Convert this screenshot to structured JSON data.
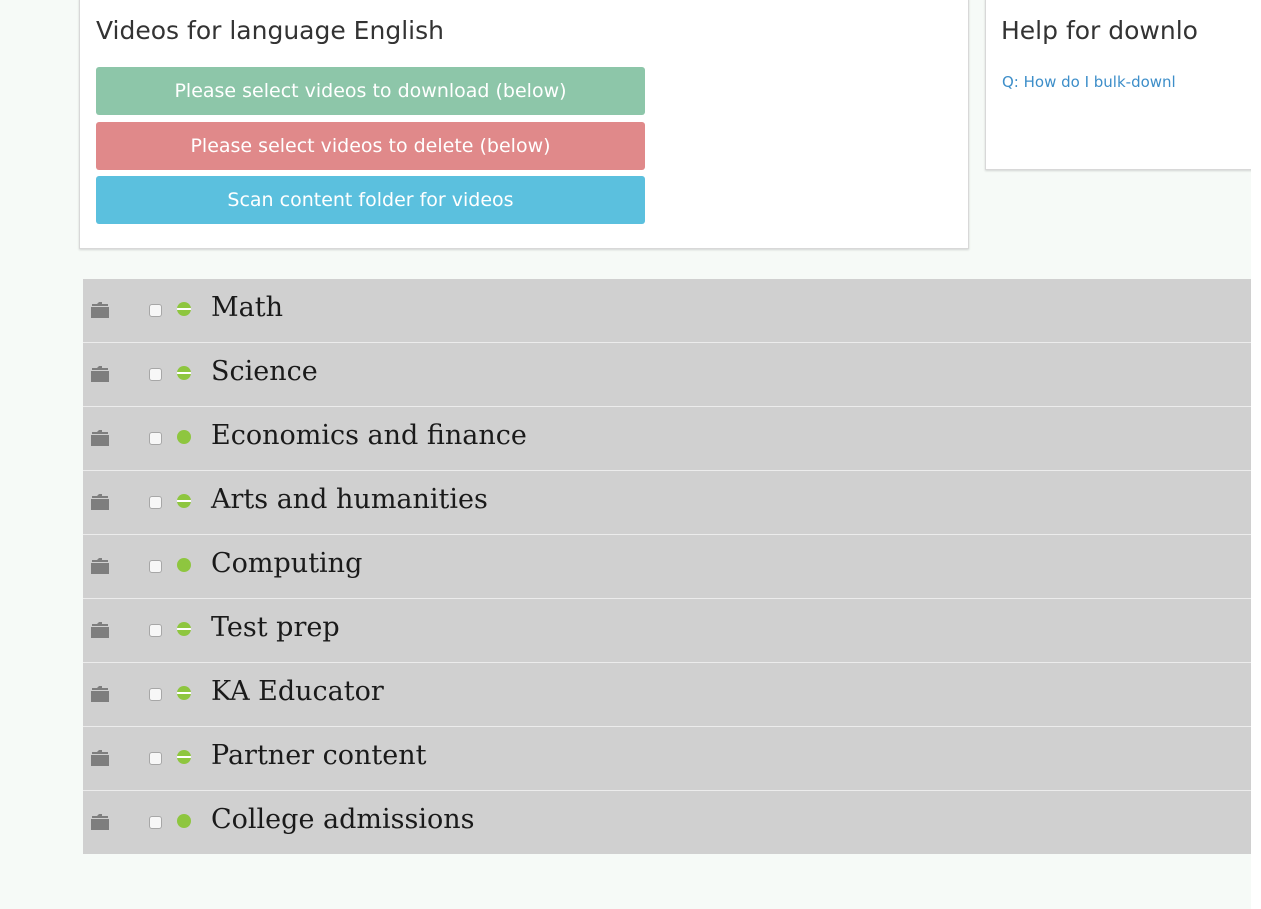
{
  "videos_panel": {
    "title": "Videos for language English",
    "download_button": "Please select videos to download (below)",
    "delete_button": "Please select videos to delete (below)",
    "scan_button": "Scan content folder for videos",
    "colors": {
      "download": "#8dc6a9",
      "delete": "#e0898a",
      "scan": "#5bc0de"
    }
  },
  "help_panel": {
    "title": "Help for downlo",
    "link": "Q: How do I bulk-downl"
  },
  "topics": [
    {
      "label": "Math",
      "status": "partial"
    },
    {
      "label": "Science",
      "status": "partial"
    },
    {
      "label": "Economics and finance",
      "status": "complete"
    },
    {
      "label": "Arts and humanities",
      "status": "partial"
    },
    {
      "label": "Computing",
      "status": "complete"
    },
    {
      "label": "Test prep",
      "status": "partial"
    },
    {
      "label": "KA Educator",
      "status": "partial"
    },
    {
      "label": "Partner content",
      "status": "partial"
    },
    {
      "label": "College admissions",
      "status": "complete"
    }
  ],
  "icons": {
    "row_folder": "folder-icon",
    "row_status": "status-dot-icon"
  },
  "status_color": "#8ec63f",
  "tree_background": "#d0d0d0"
}
